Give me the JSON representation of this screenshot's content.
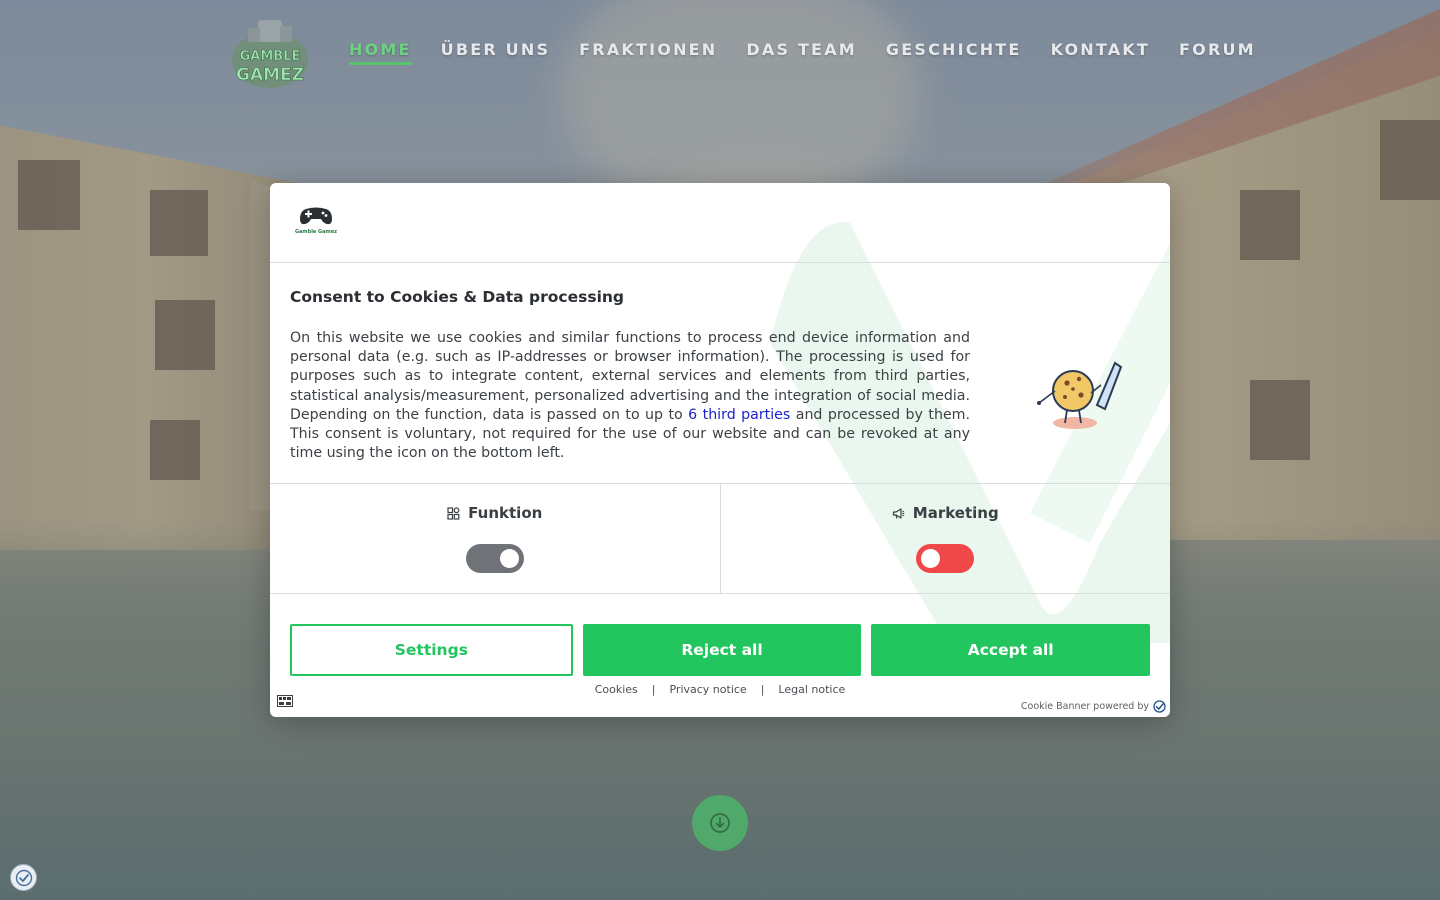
{
  "nav": {
    "items": [
      {
        "label": "HOME",
        "active": true
      },
      {
        "label": "ÜBER UNS",
        "active": false
      },
      {
        "label": "FRAKTIONEN",
        "active": false
      },
      {
        "label": "DAS TEAM",
        "active": false
      },
      {
        "label": "GESCHICHTE",
        "active": false
      },
      {
        "label": "KONTAKT",
        "active": false
      },
      {
        "label": "FORUM",
        "active": false
      }
    ],
    "active_color": "#55c46d"
  },
  "site_logo": {
    "text_line1": "GAMBLE",
    "text_line2": "GAMEZ"
  },
  "dialog": {
    "logo_text": "Gamble Gamez",
    "title": "Consent to Cookies & Data processing",
    "text_before_link": "On this website we use cookies and similar functions to process end device information and personal data (e.g. such as IP-addresses or browser information). The processing is used for purposes such as to integrate content, external services and elements from third parties, statistical analysis/measurement, personalized advertising and the integration of social media. Depending on the function, data is passed on to up to ",
    "link_text": "6 third parties",
    "text_after_link": " and processed by them. This consent is voluntary, not required for the use of our website and can be revoked at any time using the icon on the bottom left.",
    "categories": [
      {
        "label": "Funktion",
        "icon": "function-icon",
        "state": "on"
      },
      {
        "label": "Marketing",
        "icon": "megaphone-icon",
        "state": "off"
      }
    ],
    "buttons": {
      "settings": "Settings",
      "reject": "Reject all",
      "accept": "Accept all"
    },
    "links": {
      "cookies": "Cookies",
      "privacy": "Privacy notice",
      "legal": "Legal notice",
      "separator": "|"
    },
    "powered_by": "Cookie Banner powered by",
    "accent_color": "#22c55e",
    "off_color": "#f04848"
  }
}
